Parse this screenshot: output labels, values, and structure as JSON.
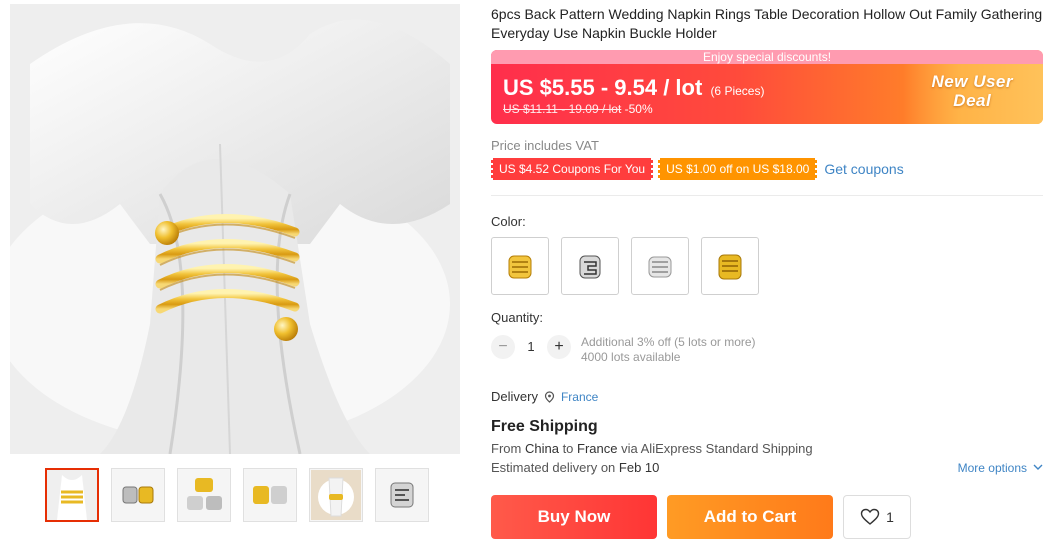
{
  "product": {
    "title": "6pcs Back Pattern Wedding Napkin Rings Table Decoration Hollow Out Family Gathering Everyday Use Napkin Buckle Holder"
  },
  "price": {
    "banner_top": "Enjoy special discounts!",
    "current": "US $5.55 - 9.54 / lot",
    "pieces": "(6 Pieces)",
    "original": "US $11.11 - 19.09 / lot",
    "discount": "-50%",
    "badge_line1": "New User",
    "badge_line2": "Deal"
  },
  "vat_note": "Price includes VAT",
  "coupons": {
    "items": [
      "US $4.52 Coupons For You",
      "US $1.00 off on US $18.00"
    ],
    "get_label": "Get coupons"
  },
  "color": {
    "label": "Color:",
    "options": [
      "gold-spiral",
      "silver-pattern",
      "silver-spiral",
      "gold-ring"
    ]
  },
  "quantity": {
    "label": "Quantity:",
    "value": "1",
    "minus": "−",
    "plus": "+",
    "note_line1": "Additional 3% off (5 lots or more)",
    "note_line2": "4000 lots available"
  },
  "delivery": {
    "label": "Delivery",
    "location": "France",
    "shipping_title": "Free Shipping",
    "from_prefix": "From",
    "from": "China",
    "to_prefix": "to",
    "to": "France",
    "via": "via AliExpress Standard Shipping",
    "eta_prefix": "Estimated delivery on",
    "eta_date": "Feb 10",
    "more_options": "More options"
  },
  "actions": {
    "buy_now": "Buy Now",
    "add_to_cart": "Add to Cart",
    "wishlist_count": "1"
  },
  "colors": {
    "accent_red": "#ff3d3d",
    "accent_orange": "#ff9400",
    "link_blue": "#3f85c5",
    "gold": "#e8b923"
  }
}
